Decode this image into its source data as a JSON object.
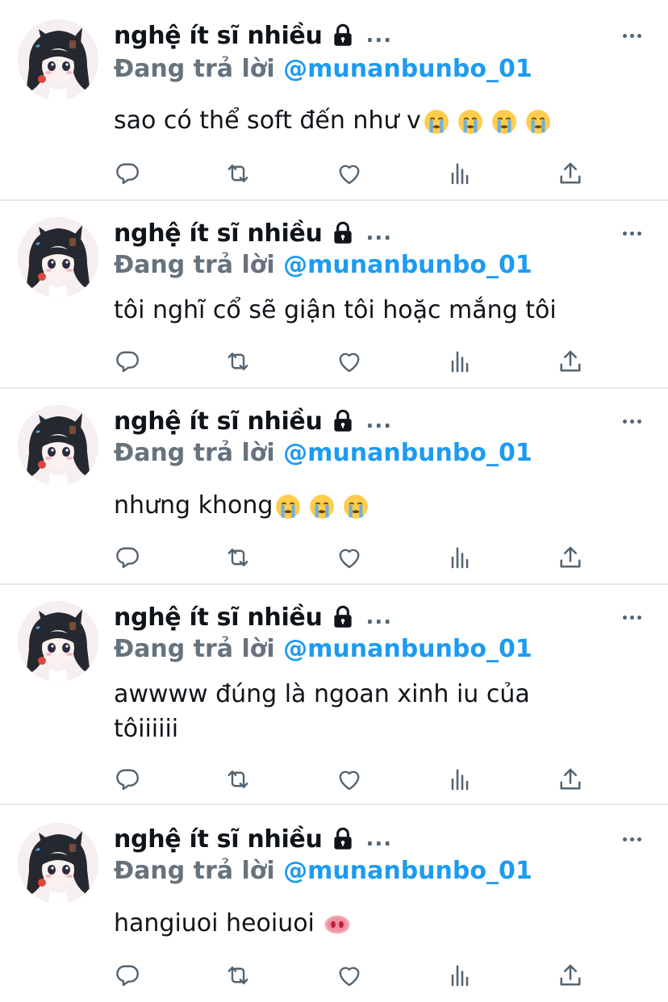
{
  "tweets": [
    {
      "display_name": "nghệ ít sĩ nhiều",
      "reply_prefix": "Đang trả lời",
      "reply_handle": "@munanbunbo_01",
      "text": "sao có thể soft đến như v",
      "emojis": [
        "loudly-crying-face",
        "loudly-crying-face",
        "loudly-crying-face",
        "loudly-crying-face"
      ]
    },
    {
      "display_name": "nghệ ít sĩ nhiều",
      "reply_prefix": "Đang trả lời",
      "reply_handle": "@munanbunbo_01",
      "text": "tôi nghĩ cổ sẽ giận tôi hoặc mắng tôi",
      "emojis": []
    },
    {
      "display_name": "nghệ ít sĩ nhiều",
      "reply_prefix": "Đang trả lời",
      "reply_handle": "@munanbunbo_01",
      "text": "nhưng khong",
      "emojis": [
        "loudly-crying-face",
        "loudly-crying-face",
        "loudly-crying-face"
      ]
    },
    {
      "display_name": "nghệ ít sĩ nhiều",
      "reply_prefix": "Đang trả lời",
      "reply_handle": "@munanbunbo_01",
      "text": "awwww đúng là ngoan xinh iu của tôiiiiii",
      "emojis": []
    },
    {
      "display_name": "nghệ ít sĩ nhiều",
      "reply_prefix": "Đang trả lời",
      "reply_handle": "@munanbunbo_01",
      "text": "hangiuoi heoiuoi ",
      "emojis": [
        "pig-nose"
      ]
    }
  ],
  "icons": {
    "lock": "lock-icon",
    "more": "more-options-icon",
    "reply": "reply-icon",
    "retweet": "retweet-icon",
    "like": "heart-icon",
    "views": "analytics-icon",
    "share": "share-icon"
  },
  "ellipsis": "...",
  "colors": {
    "text": "#0f1419",
    "secondary": "#536471",
    "reply_prefix": "#66727d",
    "link": "#1d9bf0",
    "separator": "#e6e9eb"
  }
}
